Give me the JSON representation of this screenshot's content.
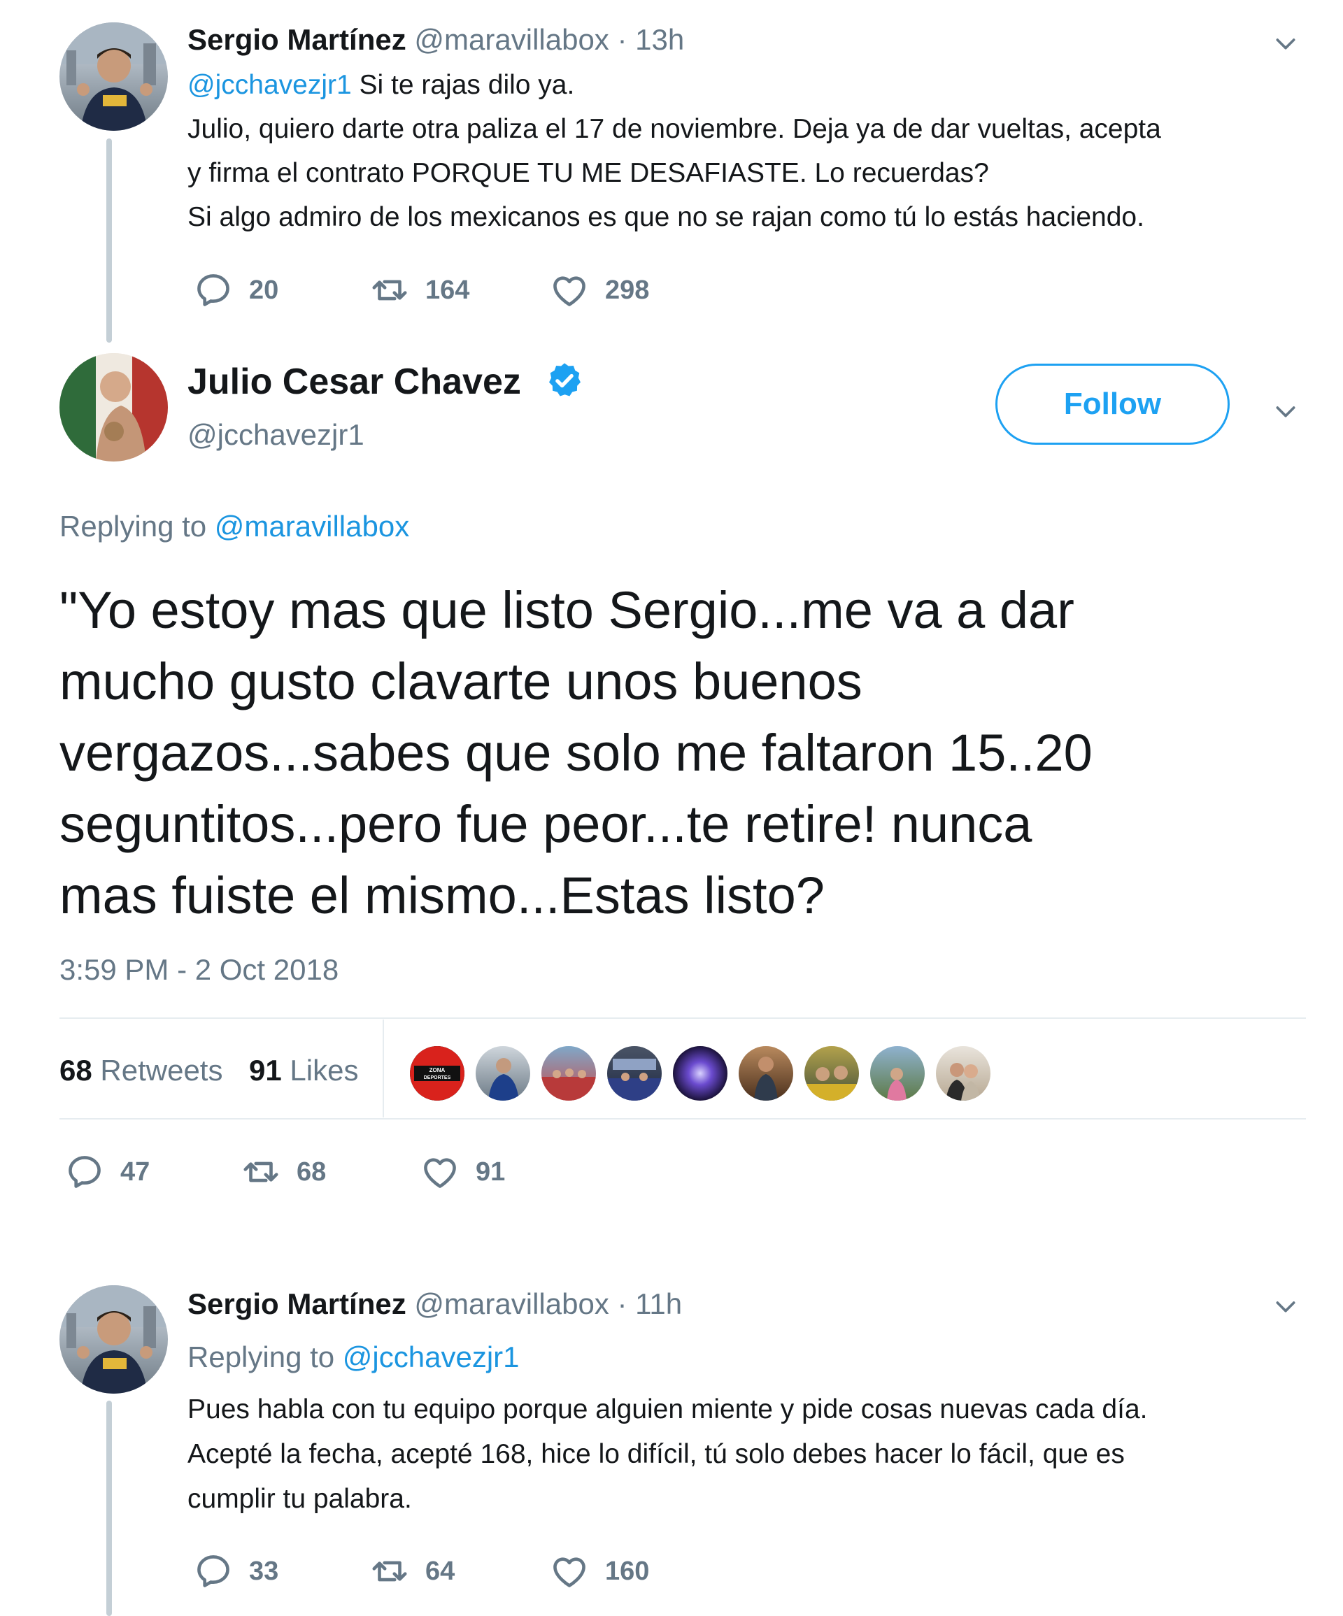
{
  "tweet1": {
    "author_name": "Sergio Martínez",
    "handle": "@maravillabox",
    "separator": "·",
    "time": "13h",
    "mention": "@jcchavezjr1",
    "line1_rest": " Si te rajas dilo ya.",
    "line2": "Julio, quiero darte otra paliza el 17 de noviembre. Deja ya de dar vueltas, acepta",
    "line3": "y firma el contrato  PORQUE TU ME DESAFIASTE. Lo recuerdas?",
    "line4": "Si algo admiro de los mexicanos es que no se rajan como tú lo estás haciendo.",
    "replies": "20",
    "retweets": "164",
    "likes": "298"
  },
  "tweet2": {
    "author_name": "Julio Cesar Chavez",
    "handle": "@jcchavezjr1",
    "follow_label": "Follow",
    "replying_prefix": "Replying to ",
    "replying_to": "@maravillabox",
    "text_lines": [
      "\"Yo estoy mas que listo Sergio...me va a dar",
      "mucho gusto clavarte unos buenos",
      "vergazos...sabes que solo me faltaron 15..20",
      "seguntitos...pero fue peor...te retire! nunca",
      "mas fuiste el mismo...Estas listo?"
    ],
    "timestamp": "3:59 PM - 2 Oct 2018",
    "retweet_count": "68",
    "retweet_label": "Retweets",
    "like_count": "91",
    "like_label": "Likes",
    "liker_badge_text": [
      "ZONA",
      "DEPORTES"
    ],
    "replies": "47",
    "retweets": "68",
    "likes": "91"
  },
  "tweet3": {
    "author_name": "Sergio Martínez",
    "handle": "@maravillabox",
    "separator": "·",
    "time": "11h",
    "replying_prefix": "Replying to ",
    "replying_to": "@jcchavezjr1",
    "line1": "Pues habla con tu equipo porque alguien miente y pide cosas nuevas cada día.",
    "line2": "Acepté la fecha, acepté 168, hice lo difícil, tú solo debes hacer lo fácil, que es",
    "line3": "cumplir tu palabra.",
    "replies": "33",
    "retweets": "64",
    "likes": "160"
  },
  "colors": {
    "link": "#1b95e0",
    "secondary_text": "#657786",
    "verified": "#1da1f2",
    "thread_line": "#c4cfd6",
    "divider": "#e6ecf0"
  },
  "icons": [
    "reply-icon",
    "retweet-icon",
    "like-icon",
    "chevron-down-icon",
    "verified-badge-icon"
  ]
}
